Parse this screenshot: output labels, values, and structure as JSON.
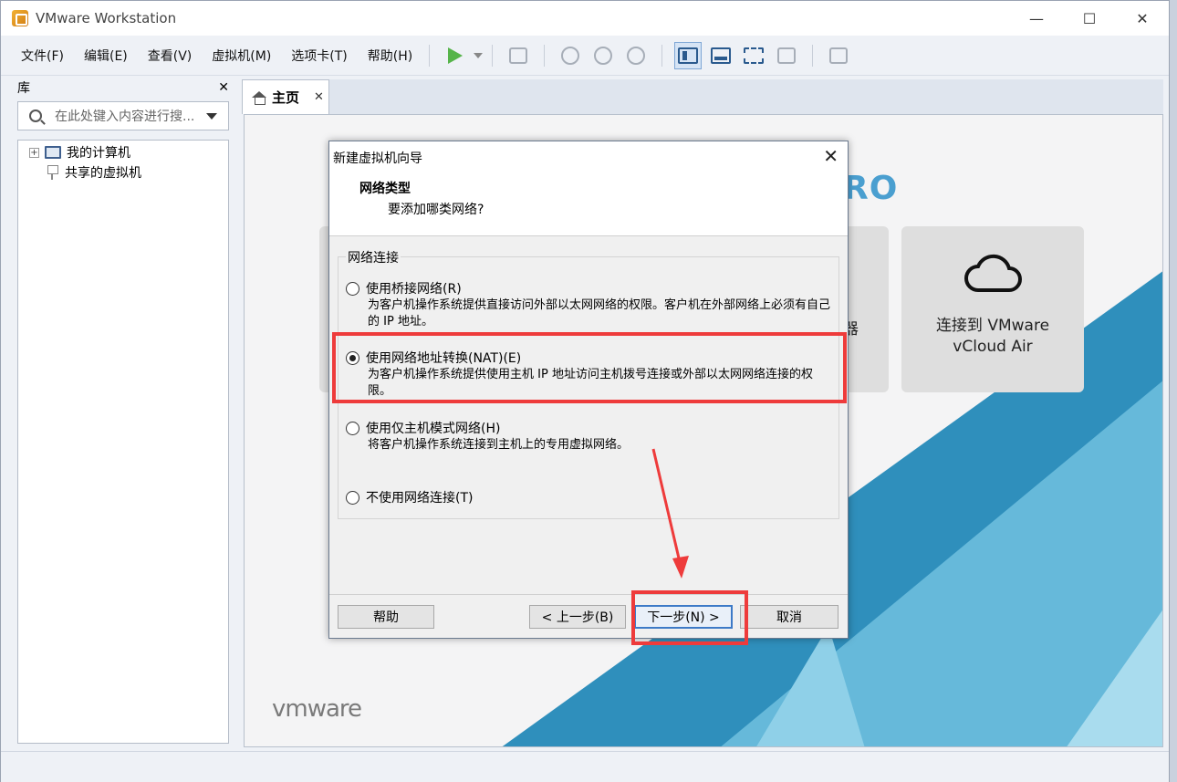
{
  "window": {
    "title": "VMware Workstation",
    "minimize": "—",
    "maximize": "☐",
    "close": "✕"
  },
  "menubar": {
    "items": [
      "文件(F)",
      "编辑(E)",
      "查看(V)",
      "虚拟机(M)",
      "选项卡(T)",
      "帮助(H)"
    ]
  },
  "library": {
    "title": "库",
    "close": "✕",
    "search_placeholder": "在此处键入内容进行搜...",
    "tree": [
      {
        "label": "我的计算机",
        "icon": "computer-icon"
      },
      {
        "label": "共享的虚拟机",
        "icon": "shared-vm-icon"
      }
    ]
  },
  "tab": {
    "label": "主页",
    "close": "✕"
  },
  "home": {
    "pro_text": "RO",
    "cloud_card_line1": "连接到 VMware",
    "cloud_card_line2": "vCloud Air",
    "partial_char": "器",
    "logo_vm": "vm",
    "logo_ware": "ware"
  },
  "dialog": {
    "title": "新建虚拟机向导",
    "close": "✕",
    "heading": "网络类型",
    "subheading": "要添加哪类网络?",
    "group_label": "网络连接",
    "options": [
      {
        "label": "使用桥接网络(R)",
        "desc": "为客户机操作系统提供直接访问外部以太网网络的权限。客户机在外部网络上必须有自己的 IP 地址。",
        "selected": false
      },
      {
        "label": "使用网络地址转换(NAT)(E)",
        "desc": "为客户机操作系统提供使用主机 IP 地址访问主机拨号连接或外部以太网网络连接的权限。",
        "selected": true
      },
      {
        "label": "使用仅主机模式网络(H)",
        "desc": "将客户机操作系统连接到主机上的专用虚拟网络。",
        "selected": false
      },
      {
        "label": "不使用网络连接(T)",
        "desc": "",
        "selected": false
      }
    ],
    "buttons": {
      "help": "帮助",
      "back": "< 上一步(B)",
      "next": "下一步(N) >",
      "cancel": "取消"
    }
  },
  "colors": {
    "annotation": "#ee3b3b",
    "accent": "#4a9fd0"
  }
}
